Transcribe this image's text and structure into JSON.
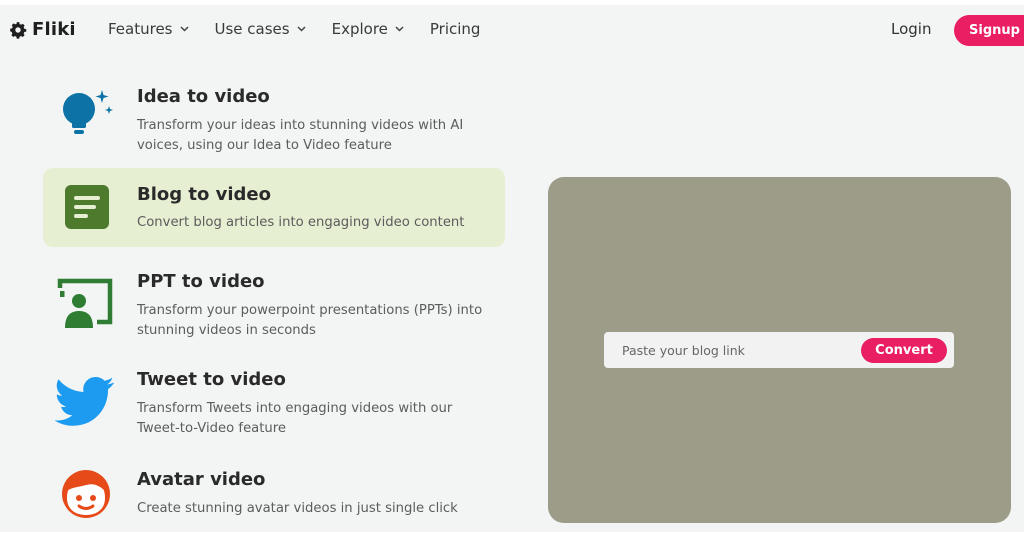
{
  "brand": {
    "name": "Fliki",
    "icon": "gear-icon"
  },
  "nav": {
    "items": [
      {
        "label": "Features",
        "has_dropdown": true
      },
      {
        "label": "Use cases",
        "has_dropdown": true
      },
      {
        "label": "Explore",
        "has_dropdown": true
      },
      {
        "label": "Pricing",
        "has_dropdown": false
      }
    ],
    "login_label": "Login",
    "signup_label": "Signup",
    "signup_arrow": "→"
  },
  "features": [
    {
      "title": "Idea to video",
      "description": "Transform your ideas into stunning videos with AI voices, using our Idea to Video feature",
      "icon": "lightbulb-icon",
      "active": false
    },
    {
      "title": "Blog to video",
      "description": "Convert blog articles into engaging video content",
      "icon": "document-icon",
      "active": true
    },
    {
      "title": "PPT to video",
      "description": "Transform your powerpoint presentations (PPTs) into stunning videos in seconds",
      "icon": "presentation-icon",
      "active": false
    },
    {
      "title": "Tweet to video",
      "description": "Transform Tweets into engaging videos with our Tweet-to-Video feature",
      "icon": "twitter-icon",
      "active": false
    },
    {
      "title": "Avatar video",
      "description": "Create stunning avatar videos in just single click",
      "icon": "avatar-icon",
      "active": false
    }
  ],
  "preview": {
    "input_placeholder": "Paste your blog link",
    "input_value": "",
    "convert_label": "Convert"
  },
  "colors": {
    "accent": "#e91e63",
    "active_feature_bg": "#e7efd3",
    "preview_bg": "#9c9c89",
    "page_bg": "#f2f5f3",
    "lightbulb": "#0d72a5",
    "document": "#4e7a2e",
    "presentation": "#2e7d32",
    "twitter": "#1d9bf0",
    "avatar": "#e64a19"
  }
}
